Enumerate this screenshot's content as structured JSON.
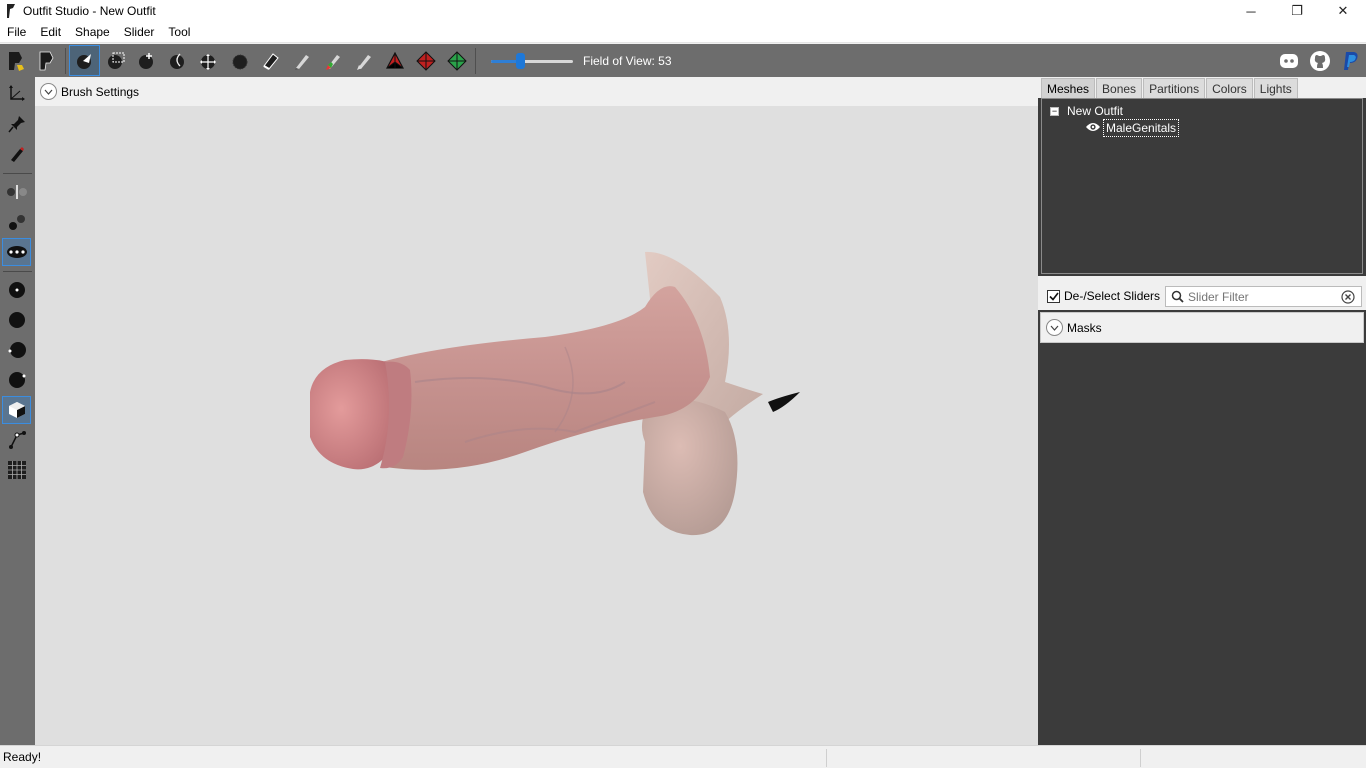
{
  "window": {
    "title": "Outfit Studio - New Outfit",
    "controls": {
      "minimize": "─",
      "maximize": "❐",
      "close": "✕"
    }
  },
  "menu": [
    "File",
    "Edit",
    "Shape",
    "Slider",
    "Tool"
  ],
  "toolbar": {
    "fov_label": "Field of View: 53",
    "fov_value": 53,
    "fov_slider_fraction": 0.35,
    "accent": "#1e78d8"
  },
  "viewport": {
    "brush_settings_label": "Brush Settings"
  },
  "right_panel": {
    "tabs": [
      "Meshes",
      "Bones",
      "Partitions",
      "Colors",
      "Lights"
    ],
    "active_tab": "Meshes",
    "tree": {
      "root": "New Outfit",
      "root_expander": "−",
      "children": [
        "MaleGenitals"
      ]
    },
    "deselect_label": "De-/Select Sliders",
    "filter_placeholder": "Slider Filter",
    "masks_label": "Masks"
  },
  "status": {
    "text": "Ready!"
  }
}
